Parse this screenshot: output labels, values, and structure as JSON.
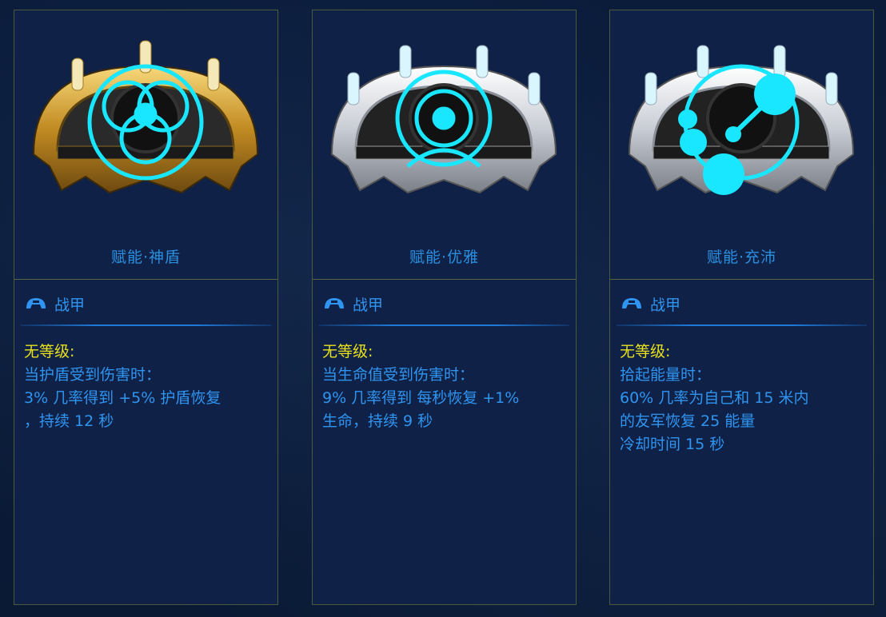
{
  "colors": {
    "accent_text": "#2f95f0",
    "rank_text": "#e8e01c",
    "card_bg": "#0f2147",
    "glyph": "#19e6ff"
  },
  "cards": [
    {
      "name": "赋能·神盾",
      "frame": "gold",
      "glyph_icon": "biohazard-glyph-icon",
      "type_icon": "warframe-helmet-icon",
      "type": "战甲",
      "rank": "无等级:",
      "lines": [
        "当护盾受到伤害时：",
        "3% 几率得到 +5% 护盾恢复",
        "，持续 12 秒"
      ]
    },
    {
      "name": "赋能·优雅",
      "frame": "silver",
      "glyph_icon": "target-glyph-icon",
      "type_icon": "warframe-helmet-icon",
      "type": "战甲",
      "rank": "无等级:",
      "lines": [
        "当生命值受到伤害时：",
        "9% 几率得到 每秒恢复 +1%",
        "生命，持续 9 秒"
      ]
    },
    {
      "name": "赋能·充沛",
      "frame": "silver",
      "glyph_icon": "orbs-glyph-icon",
      "type_icon": "warframe-helmet-icon",
      "type": "战甲",
      "rank": "无等级:",
      "lines": [
        "拾起能量时：",
        "60% 几率为自己和 15 米内",
        "的友军恢复 25 能量",
        "冷却时间 15 秒"
      ]
    }
  ]
}
